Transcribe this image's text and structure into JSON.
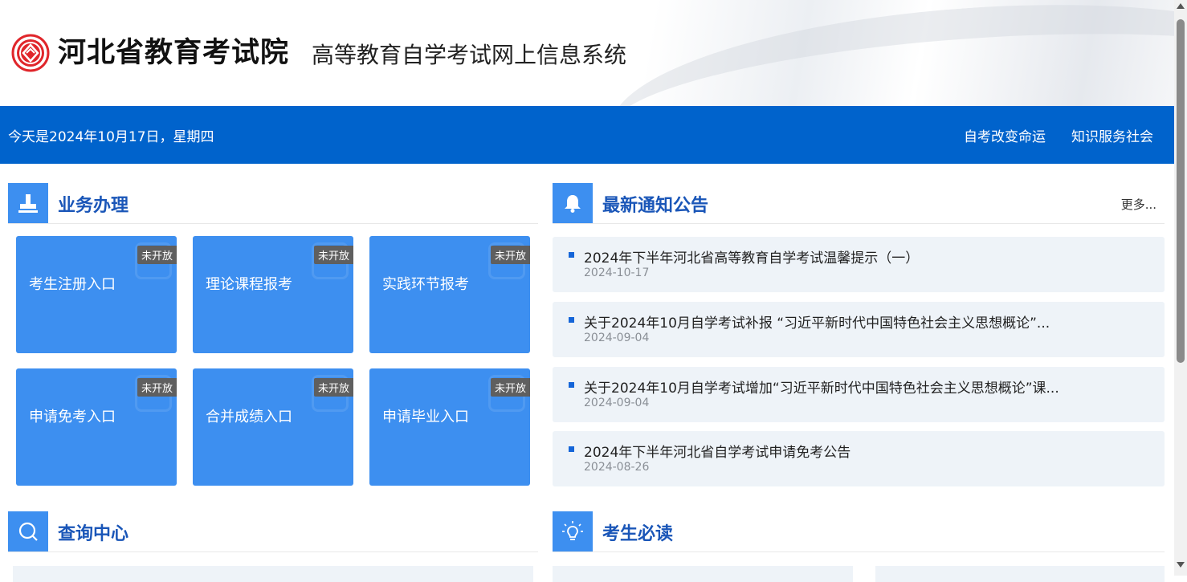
{
  "header": {
    "org_name": "河北省教育考试院",
    "system_name": "高等教育自学考试网上信息系统",
    "logo_icon": "hebei-exam-emblem-icon",
    "brand_color": "#e0262b"
  },
  "topbar": {
    "date_text": "今天是2024年10月17日，星期四",
    "slogan_1": "自考改变命运",
    "slogan_2": "知识服务社会",
    "bg_color": "#0063cc"
  },
  "business": {
    "title": "业务办理",
    "icon": "stamp-icon",
    "tiles": [
      {
        "label": "考生注册入口",
        "badge": "未开放"
      },
      {
        "label": "理论课程报考",
        "badge": "未开放"
      },
      {
        "label": "实践环节报考",
        "badge": "未开放"
      },
      {
        "label": "申请免考入口",
        "badge": "未开放"
      },
      {
        "label": "合并成绩入口",
        "badge": "未开放"
      },
      {
        "label": "申请毕业入口",
        "badge": "未开放"
      }
    ]
  },
  "notices": {
    "title": "最新通知公告",
    "icon": "bell-icon",
    "more": "更多...",
    "items": [
      {
        "title": "2024年下半年河北省高等教育自学考试温馨提示（一）",
        "date": "2024-10-17"
      },
      {
        "title": "关于2024年10月自学考试补报 “习近平新时代中国特色社会主义思想概论”...",
        "date": "2024-09-04"
      },
      {
        "title": "关于2024年10月自学考试增加“习近平新时代中国特色社会主义思想概论”课...",
        "date": "2024-09-04"
      },
      {
        "title": "2024年下半年河北省自学考试申请免考公告",
        "date": "2024-08-26"
      }
    ]
  },
  "query": {
    "title": "查询中心",
    "icon": "search-icon"
  },
  "guide": {
    "title": "考生必读",
    "icon": "lightbulb-icon"
  },
  "accent_color": "#3d8ff0"
}
